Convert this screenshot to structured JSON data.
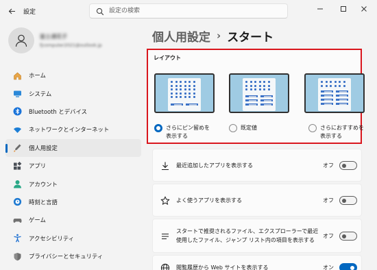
{
  "window": {
    "title": "設定",
    "back_icon": "back-arrow-icon",
    "minimize_icon": "minimize-icon",
    "maximize_icon": "maximize-icon",
    "close_icon": "close-icon"
  },
  "search": {
    "placeholder": "設定の検索"
  },
  "profile": {
    "name": "富士通花子",
    "email": "fjcomputer2021@outlook.jp"
  },
  "sidebar": {
    "items": [
      {
        "label": "ホーム",
        "icon": "home-icon"
      },
      {
        "label": "システム",
        "icon": "system-icon"
      },
      {
        "label": "Bluetooth とデバイス",
        "icon": "bluetooth-icon"
      },
      {
        "label": "ネットワークとインターネット",
        "icon": "wifi-icon"
      },
      {
        "label": "個人用設定",
        "icon": "personalization-icon",
        "selected": true
      },
      {
        "label": "アプリ",
        "icon": "apps-icon"
      },
      {
        "label": "アカウント",
        "icon": "account-icon"
      },
      {
        "label": "時刻と言語",
        "icon": "time-language-icon"
      },
      {
        "label": "ゲーム",
        "icon": "gaming-icon"
      },
      {
        "label": "アクセシビリティ",
        "icon": "accessibility-icon"
      },
      {
        "label": "プライバシーとセキュリティ",
        "icon": "shield-icon"
      }
    ]
  },
  "breadcrumb": {
    "parent": "個人用設定",
    "separator": "›",
    "current": "スタート"
  },
  "layout": {
    "title": "レイアウト",
    "options": [
      {
        "label": "さらにピン留めを表示する",
        "line1": "さらにピン留めを",
        "line2": "表示する",
        "checked": true
      },
      {
        "label": "既定値",
        "line1": "既定値",
        "line2": "",
        "checked": false
      },
      {
        "label": "さらにおすすめを表示する",
        "line1": "さらにおすすめを",
        "line2": "表示する",
        "checked": false
      }
    ]
  },
  "settings": [
    {
      "icon": "download-icon",
      "label": "最近追加したアプリを表示する",
      "state": "オフ",
      "on": false
    },
    {
      "icon": "star-icon",
      "label": "よく使うアプリを表示する",
      "state": "オフ",
      "on": false
    },
    {
      "icon": "list-icon",
      "line1": "スタートで推奨されるファイル、エクスプローラーで最近",
      "line2": "使用したファイル、ジャンプ リスト内の項目を表示する",
      "state": "オフ",
      "on": false
    },
    {
      "icon": "globe-icon",
      "label": "閲覧履歴から Web サイトを表示する",
      "state": "オン",
      "on": true
    }
  ],
  "colors": {
    "accent": "#0067c0",
    "highlight_border": "#d9151c"
  }
}
